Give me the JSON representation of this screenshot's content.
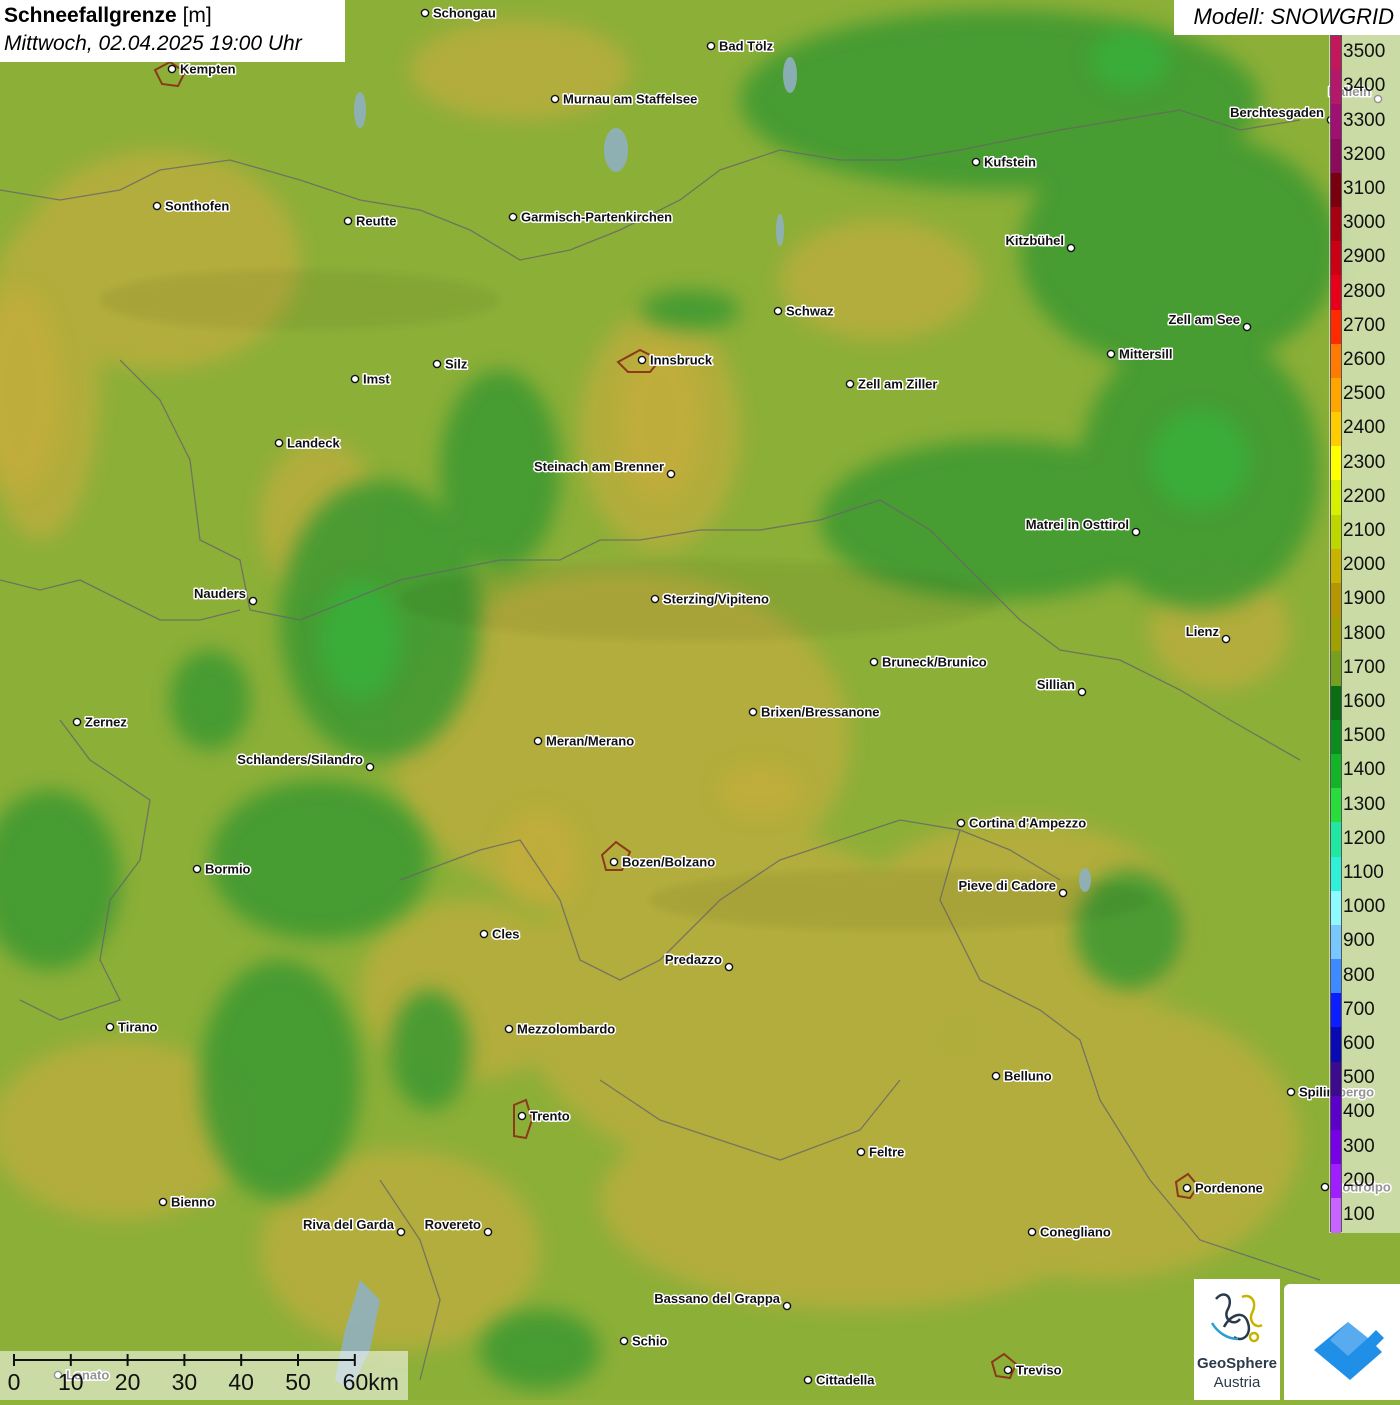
{
  "title": {
    "main": "Schneefallgrenze",
    "unit": "[m]",
    "datetime": "Mittwoch, 02.04.2025 19:00 Uhr"
  },
  "model": {
    "label": "Modell: SNOWGRID"
  },
  "legend": {
    "items": [
      {
        "value": "3500",
        "color": "#c2185b"
      },
      {
        "value": "3400",
        "color": "#b5176a"
      },
      {
        "value": "3300",
        "color": "#a01070"
      },
      {
        "value": "3200",
        "color": "#8b0a5a"
      },
      {
        "value": "3100",
        "color": "#7a0010"
      },
      {
        "value": "3000",
        "color": "#a80010"
      },
      {
        "value": "2900",
        "color": "#cc0015"
      },
      {
        "value": "2800",
        "color": "#e8001a"
      },
      {
        "value": "2700",
        "color": "#ff2a00"
      },
      {
        "value": "2600",
        "color": "#ff7a00"
      },
      {
        "value": "2500",
        "color": "#ffa500"
      },
      {
        "value": "2400",
        "color": "#ffcc00"
      },
      {
        "value": "2300",
        "color": "#ffff00"
      },
      {
        "value": "2200",
        "color": "#d6f000"
      },
      {
        "value": "2100",
        "color": "#bcd600"
      },
      {
        "value": "2000",
        "color": "#c8b400"
      },
      {
        "value": "1900",
        "color": "#b49600"
      },
      {
        "value": "1800",
        "color": "#a0a000"
      },
      {
        "value": "1700",
        "color": "#78a020"
      },
      {
        "value": "1600",
        "color": "#0a6e14"
      },
      {
        "value": "1500",
        "color": "#0a8c1e"
      },
      {
        "value": "1400",
        "color": "#14b428"
      },
      {
        "value": "1300",
        "color": "#28dc3c"
      },
      {
        "value": "1200",
        "color": "#20e8a0"
      },
      {
        "value": "1100",
        "color": "#30f0d8"
      },
      {
        "value": "1000",
        "color": "#8cfaff"
      },
      {
        "value": "900",
        "color": "#78c8ff"
      },
      {
        "value": "800",
        "color": "#3c8cff"
      },
      {
        "value": "700",
        "color": "#0a1eff"
      },
      {
        "value": "600",
        "color": "#0a0ab4"
      },
      {
        "value": "500",
        "color": "#3c0a8c"
      },
      {
        "value": "400",
        "color": "#5a00c8"
      },
      {
        "value": "300",
        "color": "#7800e6"
      },
      {
        "value": "200",
        "color": "#a01eff"
      },
      {
        "value": "100",
        "color": "#c864ff"
      }
    ]
  },
  "cities": [
    {
      "name": "Schongau"
    },
    {
      "name": "Bad Tölz"
    },
    {
      "name": "Kempten"
    },
    {
      "name": "Murnau am Staffelsee"
    },
    {
      "name": "Hallein"
    },
    {
      "name": "Berchtesgaden"
    },
    {
      "name": "Kufstein"
    },
    {
      "name": "Sonthofen"
    },
    {
      "name": "Reutte"
    },
    {
      "name": "Garmisch-Partenkirchen"
    },
    {
      "name": "Kitzbühel"
    },
    {
      "name": "Schwaz"
    },
    {
      "name": "Zell am See"
    },
    {
      "name": "Innsbruck"
    },
    {
      "name": "Mittersill"
    },
    {
      "name": "Silz"
    },
    {
      "name": "Imst"
    },
    {
      "name": "Zell am Ziller"
    },
    {
      "name": "Landeck"
    },
    {
      "name": "Steinach am Brenner"
    },
    {
      "name": "Matrei in Osttirol"
    },
    {
      "name": "Nauders"
    },
    {
      "name": "Sterzing/Vipiteno"
    },
    {
      "name": "Lienz"
    },
    {
      "name": "Bruneck/Brunico"
    },
    {
      "name": "Sillian"
    },
    {
      "name": "Brixen/Bressanone"
    },
    {
      "name": "Zernez"
    },
    {
      "name": "Meran/Merano"
    },
    {
      "name": "Schlanders/Silandro"
    },
    {
      "name": "Cortina d'Ampezzo"
    },
    {
      "name": "Bozen/Bolzano"
    },
    {
      "name": "Bormio"
    },
    {
      "name": "Pieve di Cadore"
    },
    {
      "name": "Cles"
    },
    {
      "name": "Predazzo"
    },
    {
      "name": "Tirano"
    },
    {
      "name": "Mezzolombardo"
    },
    {
      "name": "Belluno"
    },
    {
      "name": "Spilimbergo"
    },
    {
      "name": "Trento"
    },
    {
      "name": "Feltre"
    },
    {
      "name": "Pordenone"
    },
    {
      "name": "Bienno"
    },
    {
      "name": "Riva del Garda"
    },
    {
      "name": "Rovereto"
    },
    {
      "name": "Conegliano"
    },
    {
      "name": "Bassano del Grappa"
    },
    {
      "name": "Schio"
    },
    {
      "name": "Treviso"
    },
    {
      "name": "Cittadella"
    },
    {
      "name": "Lonato"
    },
    {
      "name": "Codroipo"
    }
  ],
  "scalebar": {
    "labels": [
      "0",
      "10",
      "20",
      "30",
      "40",
      "50",
      "60km"
    ]
  },
  "logos": {
    "geosphere_line1": "GeoSphere",
    "geosphere_line2": "Austria"
  }
}
